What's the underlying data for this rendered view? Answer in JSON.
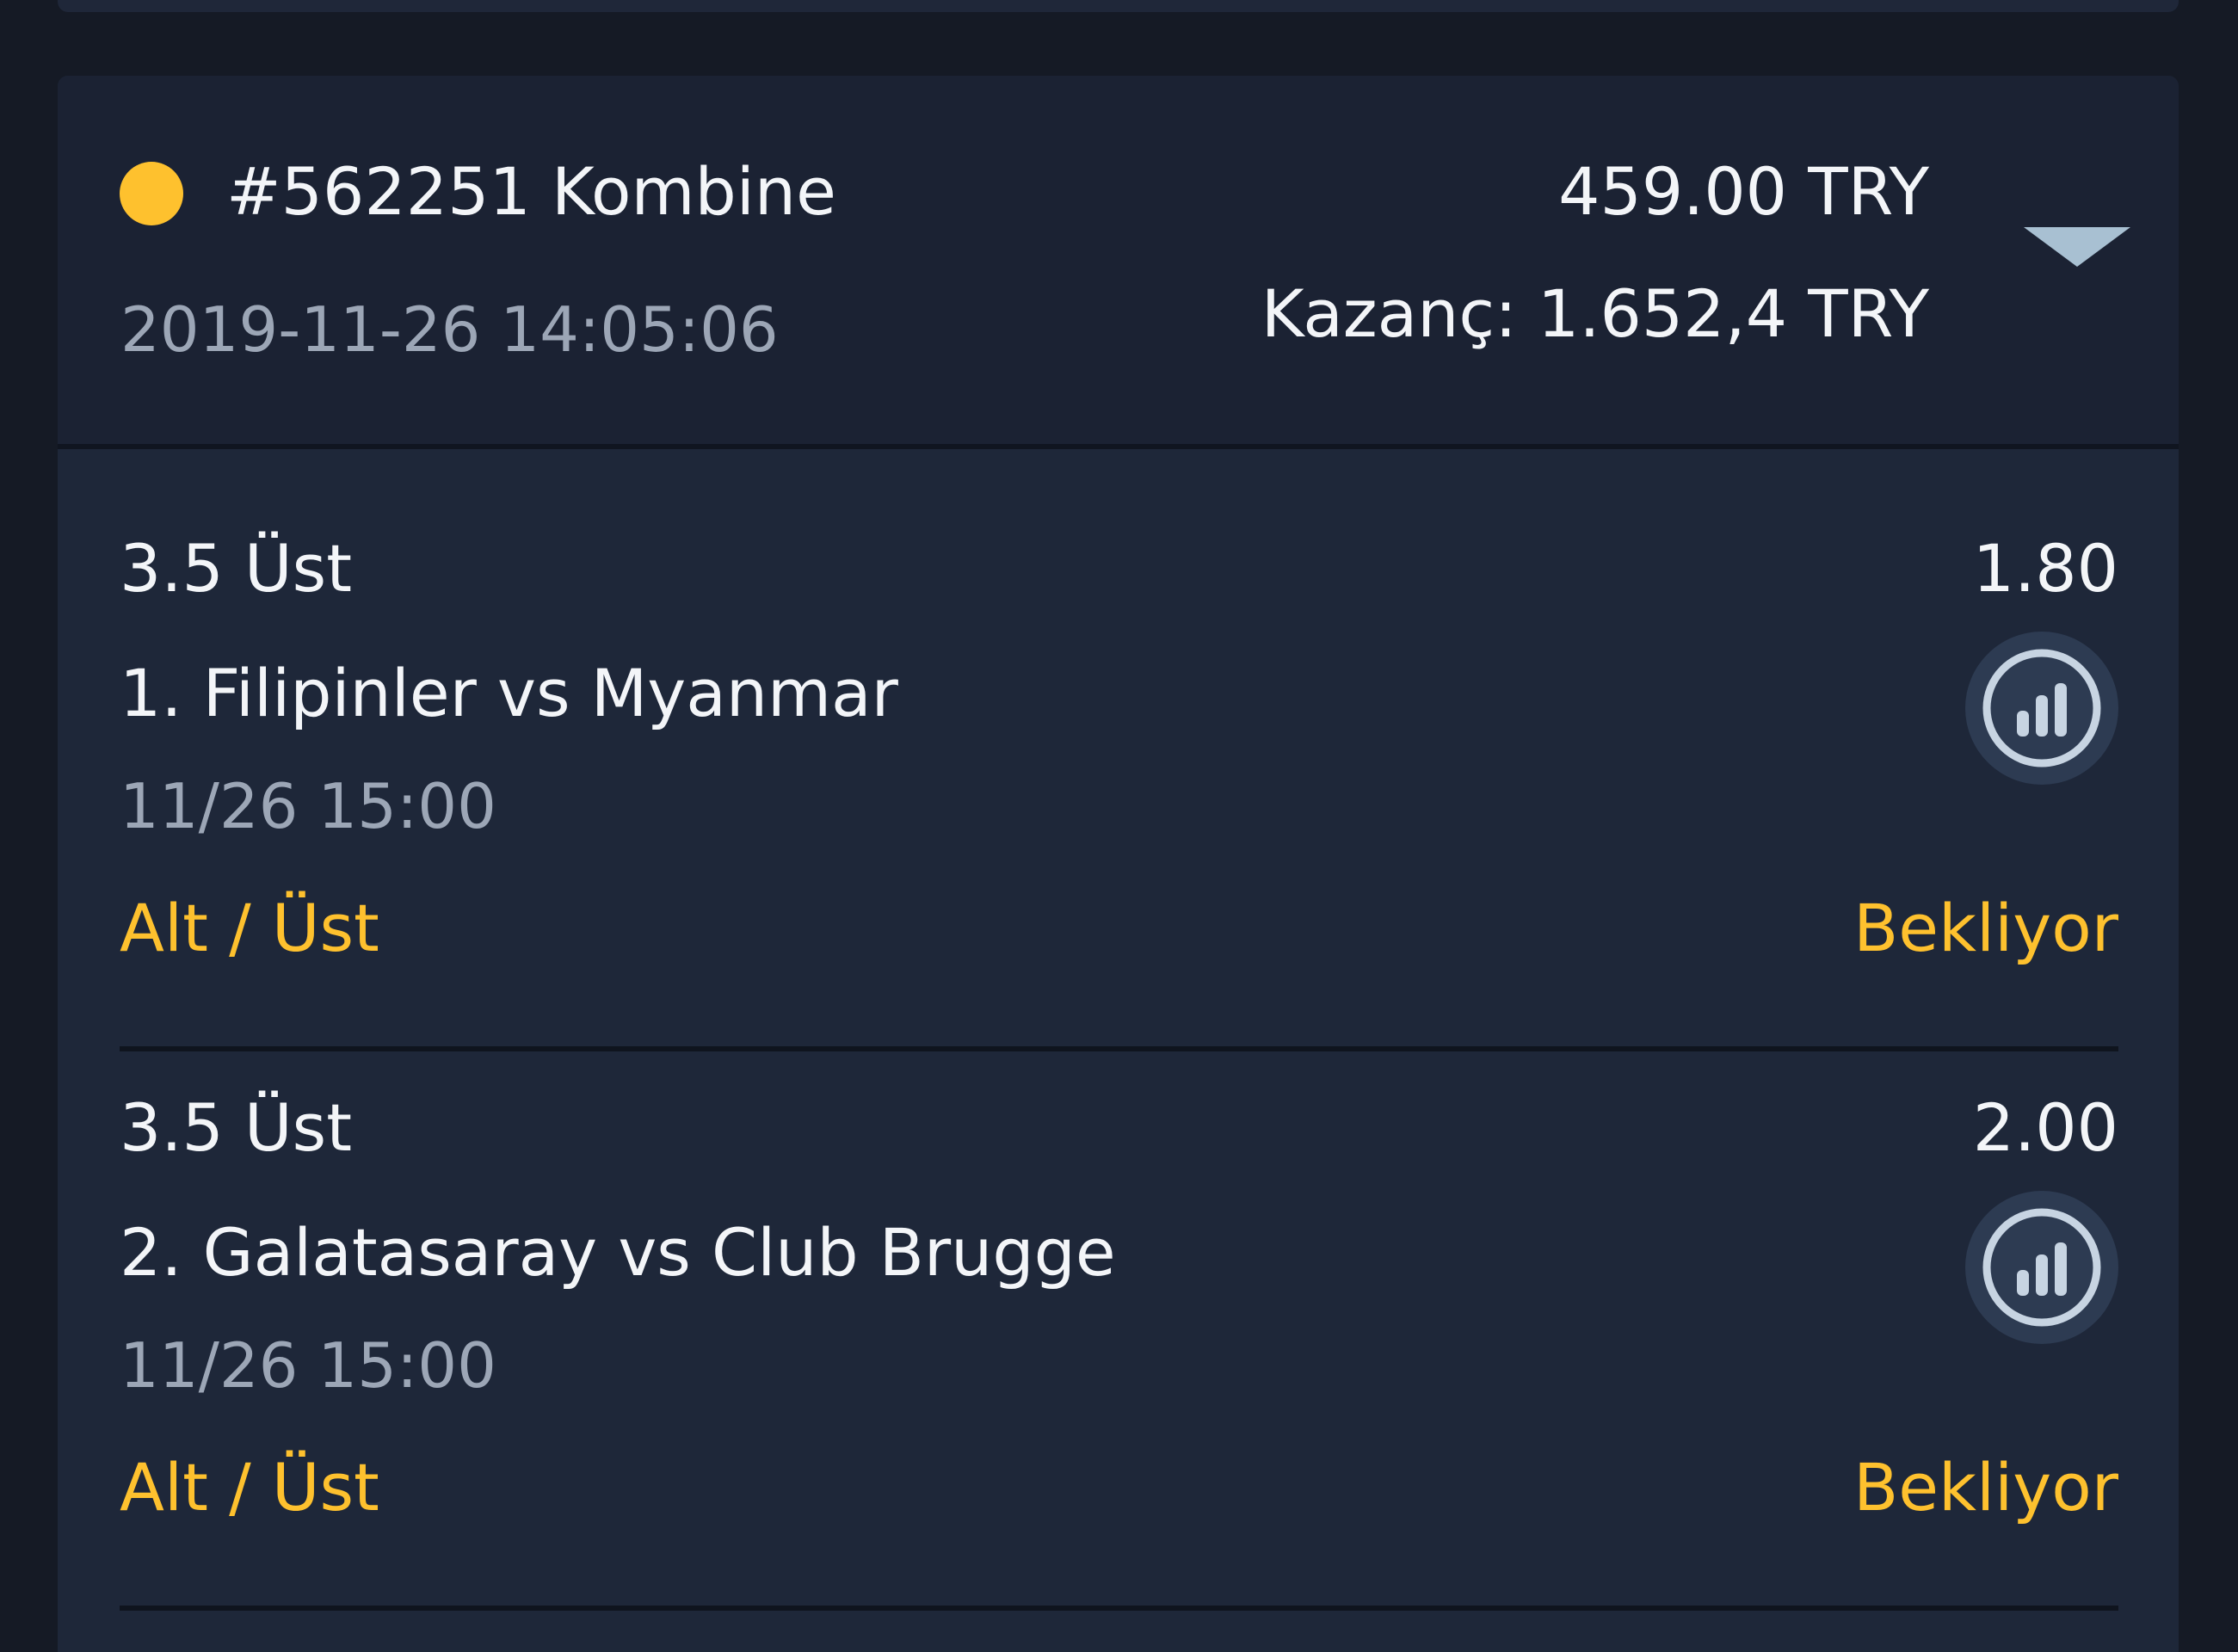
{
  "bet": {
    "title": "#562251 Kombine",
    "datetime": "2019-11-26 14:05:06",
    "stake": "459.00 TRY",
    "winnings": "Kazanç: 1.652,4 TRY",
    "status_color": "#fec12e",
    "expand_icon": "chevron-down-icon"
  },
  "selections": [
    {
      "market": "3.5 Üst",
      "odds": "1.80",
      "match": "1. Filipinler vs Myanmar",
      "time": "11/26 15:00",
      "bet_type": "Alt / Üst",
      "status": "Bekliyor",
      "stats_icon": "bar-chart-icon"
    },
    {
      "market": "3.5 Üst",
      "odds": "2.00",
      "match": "2. Galatasaray vs Club Brugge",
      "time": "11/26 15:00",
      "bet_type": "Alt / Üst",
      "status": "Bekliyor",
      "stats_icon": "bar-chart-icon"
    }
  ],
  "colors": {
    "accent": "#fec12e",
    "background": "#151a25",
    "card": "#1e2739",
    "header": "#1b2233",
    "muted_text": "#9ca6b6"
  }
}
